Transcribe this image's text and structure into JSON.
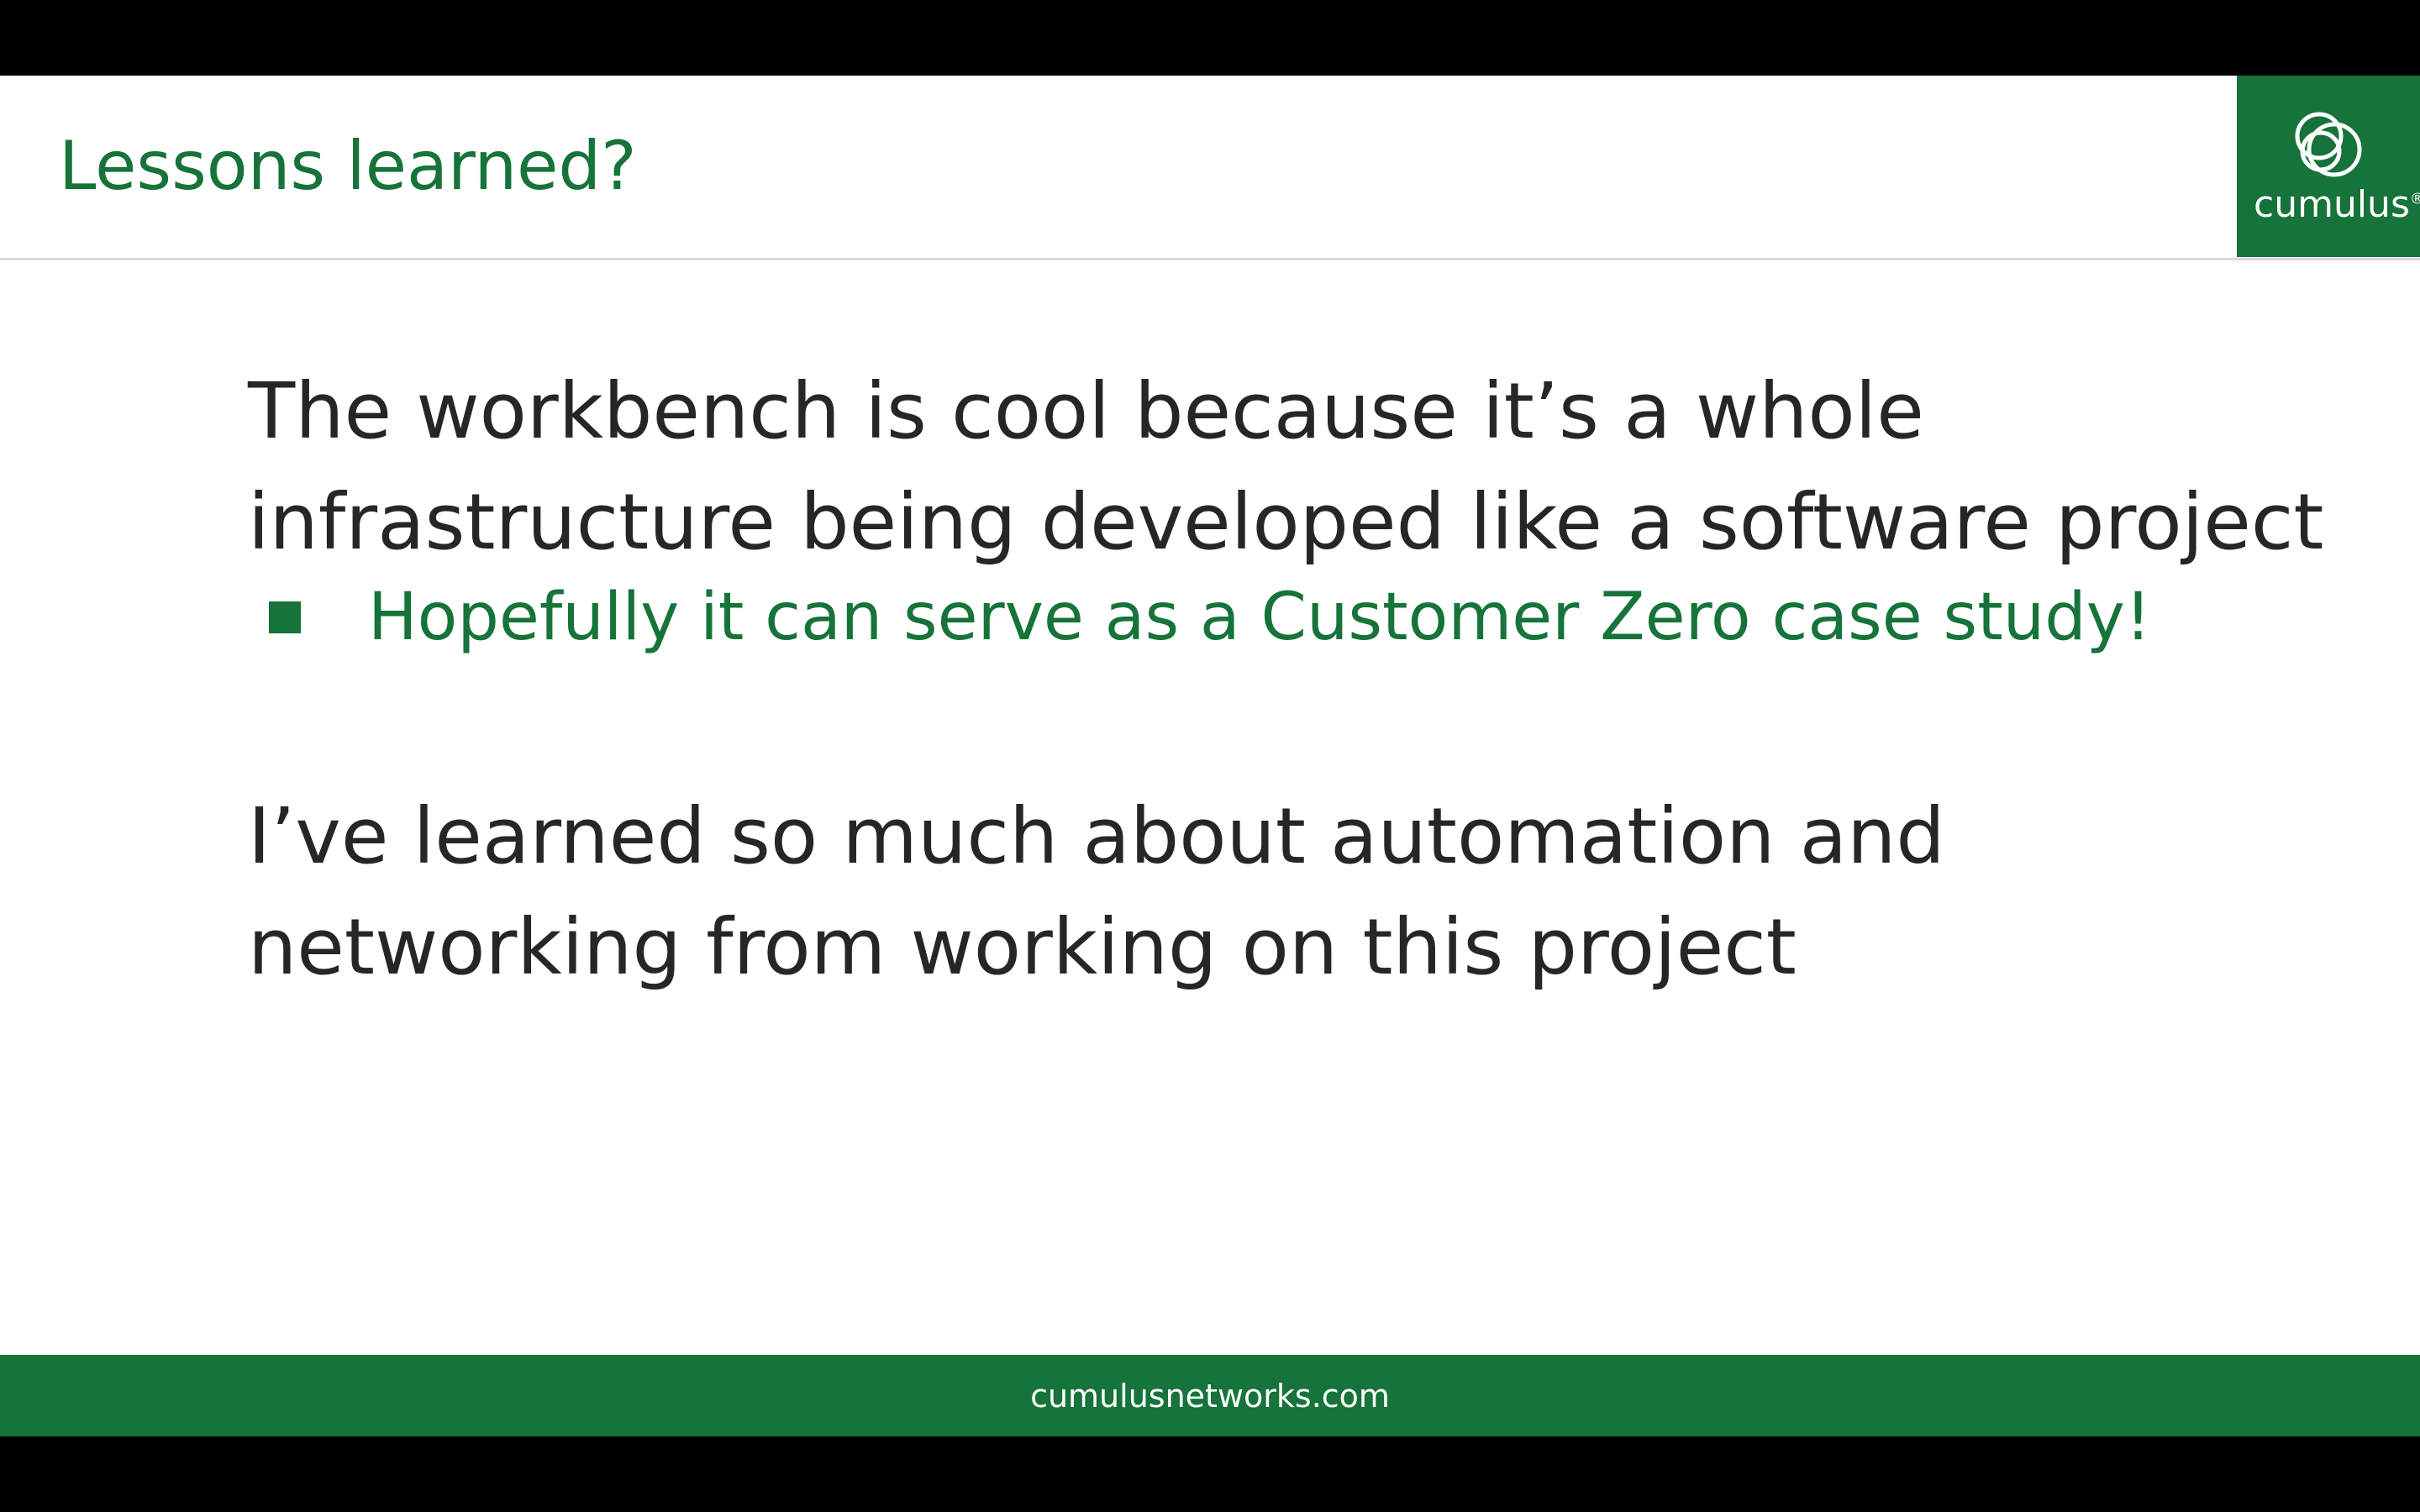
{
  "slide": {
    "title": "Lessons learned?",
    "logo": {
      "text": "cumulus",
      "trademark": "®",
      "icon": "cumulus-rings-icon"
    },
    "paragraphs": [
      {
        "lines": [
          "The workbench is cool because it’s a whole",
          "infrastructure being developed like a software project"
        ]
      },
      {
        "lines": [
          "I’ve learned so much about automation and",
          "networking from working on this project"
        ]
      }
    ],
    "bullet": {
      "icon": "square-bullet-icon",
      "text": "Hopefully it can serve as a Customer Zero case study!"
    },
    "footer": {
      "text": "cumulusnetworks.com"
    }
  },
  "colors": {
    "brand_green": "#16733a",
    "body_text": "#262626",
    "background": "#ffffff",
    "letterbox": "#000000",
    "divider": "#d9d9d9"
  }
}
